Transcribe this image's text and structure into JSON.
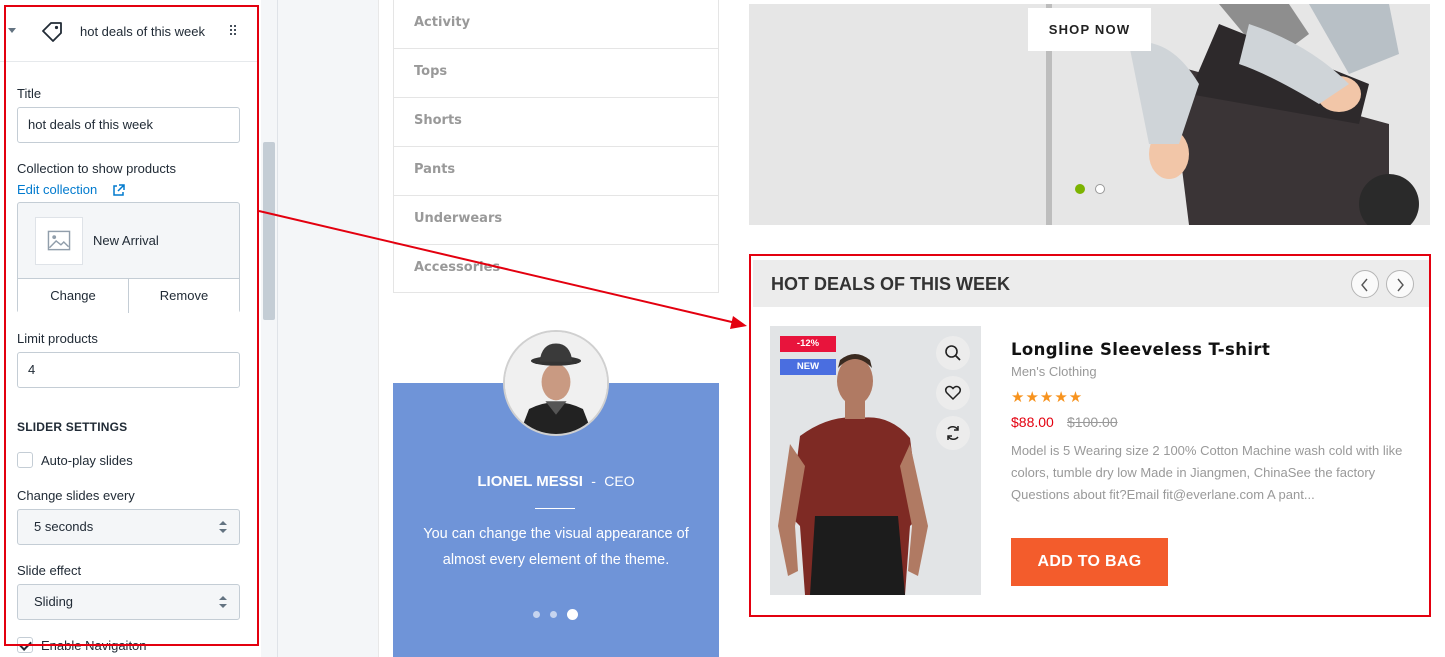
{
  "editor": {
    "section_title": "hot deals of this week",
    "title_label": "Title",
    "title_value": "hot deals of this week",
    "collection_label": "Collection to show products",
    "edit_collection_link": "Edit collection",
    "collection_name": "New Arrival",
    "change_button": "Change",
    "remove_button": "Remove",
    "limit_label": "Limit products",
    "limit_value": "4",
    "slider_settings_heading": "SLIDER SETTINGS",
    "autoplay_label": "Auto-play slides",
    "autoplay_checked": false,
    "change_every_label": "Change slides every",
    "change_every_value": "5 seconds",
    "slide_effect_label": "Slide effect",
    "slide_effect_value": "Sliding",
    "enable_navigation_label": "Enable Navigaiton",
    "enable_navigation_checked": true
  },
  "preview": {
    "categories": [
      "Activity",
      "Tops",
      "Shorts",
      "Pants",
      "Underwears",
      "Accessories"
    ],
    "banner_button": "SHOP NOW",
    "testimonial": {
      "name": "LIONEL MESSI",
      "separator": "-",
      "role": "CEO",
      "quote": "You can change the visual appearance of almost every element of the theme.",
      "active_dot": 3,
      "dot_count": 3
    },
    "deals": {
      "heading": "HOT DEALS OF THIS WEEK",
      "product": {
        "discount_badge": "-12%",
        "new_badge": "NEW",
        "name": "Longline Sleeveless T-shirt",
        "category": "Men's Clothing",
        "rating": 5,
        "stars": "★★★★★",
        "price": "$88.00",
        "old_price": "$100.00",
        "description": "Model is 5 Wearing size 2 100% Cotton Machine wash cold with like colors, tumble dry low Made in Jiangmen, ChinaSee the factory Questions about fit?Email fit@everlane.com A pant...",
        "add_to_bag": "ADD TO BAG"
      }
    }
  },
  "colors": {
    "annotation_red": "#e3000f",
    "add_to_bag": "#f35c2c",
    "testimonial_bg": "#6f94d8",
    "link_blue": "#007ace",
    "star": "#f7931e",
    "banner_dot_active": "#7cb300"
  },
  "icons": [
    "chevron-down-icon",
    "tag-icon",
    "drag-handle-icon",
    "external-link-icon",
    "image-placeholder-icon",
    "select-arrows-icon",
    "checkbox-icon",
    "search-icon",
    "heart-icon",
    "compare-icon",
    "chevron-left-icon",
    "chevron-right-icon"
  ]
}
